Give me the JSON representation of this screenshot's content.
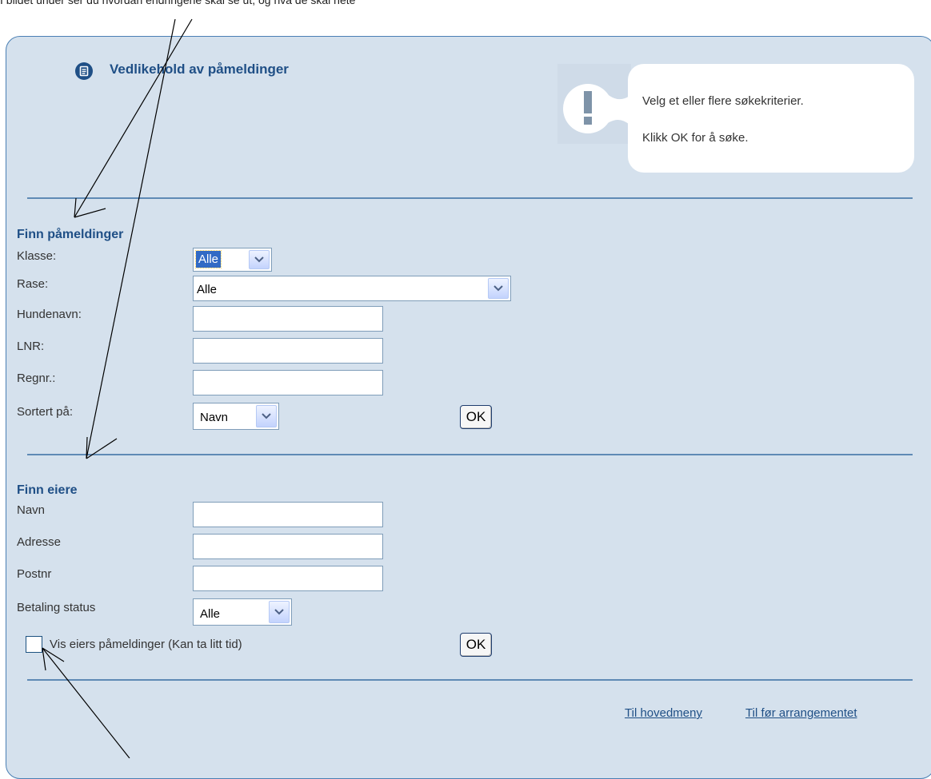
{
  "caption": "I bildet under ser du hvordan endringene skal se ut, og hva de skal hete",
  "header": {
    "title": "Vedlikehold av påmeldinger",
    "icon": "document-icon"
  },
  "notice": {
    "icon": "exclamation-icon",
    "line1": "Velg et eller flere søkekriterier.",
    "line2": "Klikk OK for å søke."
  },
  "find_registrations": {
    "title": "Finn påmeldinger",
    "klasse_label": "Klasse:",
    "klasse_value": "Alle",
    "rase_label": "Rase:",
    "rase_value": "Alle",
    "hundenavn_label": "Hundenavn:",
    "hundenavn_value": "",
    "lnr_label": "LNR:",
    "lnr_value": "",
    "regnr_label": "Regnr.:",
    "regnr_value": "",
    "sort_label": "Sortert på:",
    "sort_value": "Navn",
    "ok_label": "OK"
  },
  "find_owners": {
    "title": "Finn eiere",
    "navn_label": "Navn",
    "navn_value": "",
    "adresse_label": "Adresse",
    "adresse_value": "",
    "postnr_label": "Postnr",
    "postnr_value": "",
    "payment_label": "Betaling status",
    "payment_value": "Alle",
    "show_registrations_label": "Vis eiers påmeldinger (Kan ta litt tid)",
    "show_registrations_checked": false,
    "ok_label": "OK"
  },
  "footer": {
    "main_menu_link": "Til hovedmeny",
    "before_event_link": "Til før arrangementet"
  },
  "colors": {
    "panel_background": "#d5e1ed",
    "panel_border": "#4a7fb4",
    "heading": "#1f4f86",
    "divider": "#5f8ab5"
  }
}
